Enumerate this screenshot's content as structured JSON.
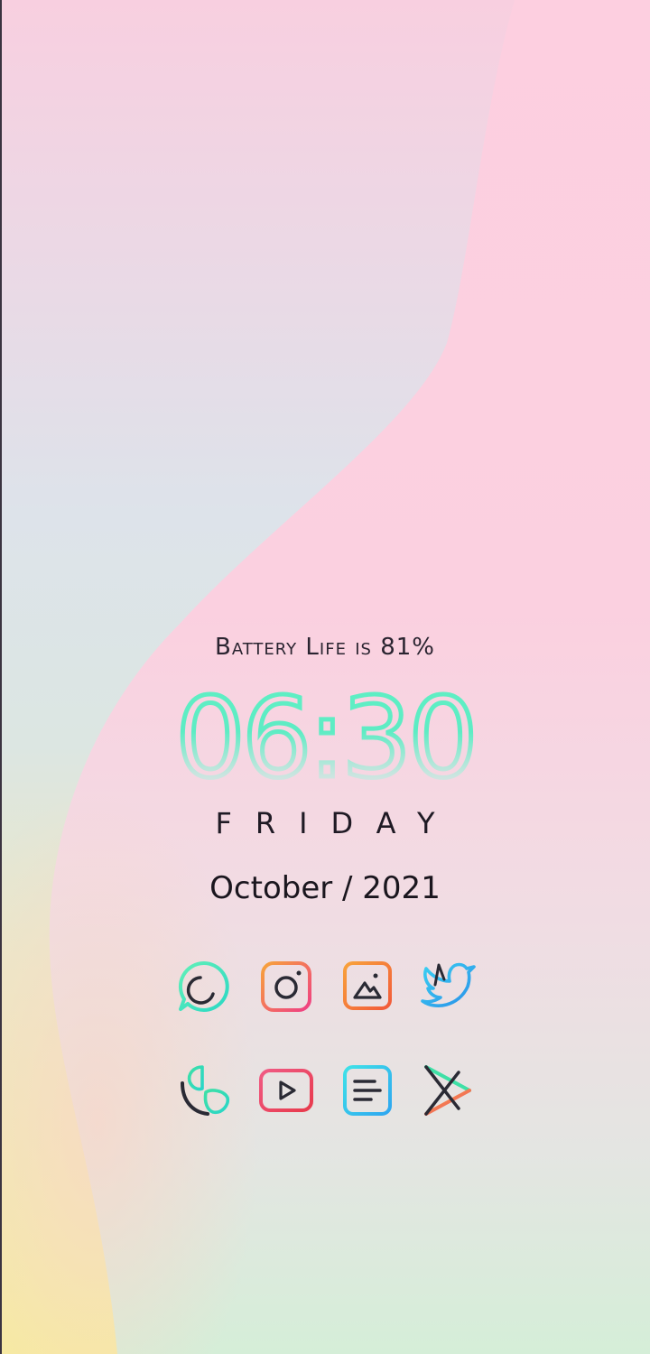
{
  "battery": {
    "text": "Battery Life is 81%"
  },
  "clock": {
    "time": "06:30"
  },
  "day": {
    "text": "FRIDAY"
  },
  "date": {
    "text": "October / 2021"
  },
  "apps": [
    {
      "name": "whatsapp-icon"
    },
    {
      "name": "instagram-icon"
    },
    {
      "name": "gallery-icon"
    },
    {
      "name": "twitter-icon"
    },
    {
      "name": "phone-icon"
    },
    {
      "name": "youtube-icon"
    },
    {
      "name": "notes-icon"
    },
    {
      "name": "play-store-icon"
    }
  ],
  "colors": {
    "clock_gradient_top": "#5ff0c3",
    "clock_gradient_bottom": "#f5e8ef",
    "wallpaper_pink": "#fbcfe0",
    "wallpaper_blue": "#dfe6ee",
    "wallpaper_yellow": "#f6eba0",
    "wallpaper_mint": "#d5eed8"
  }
}
